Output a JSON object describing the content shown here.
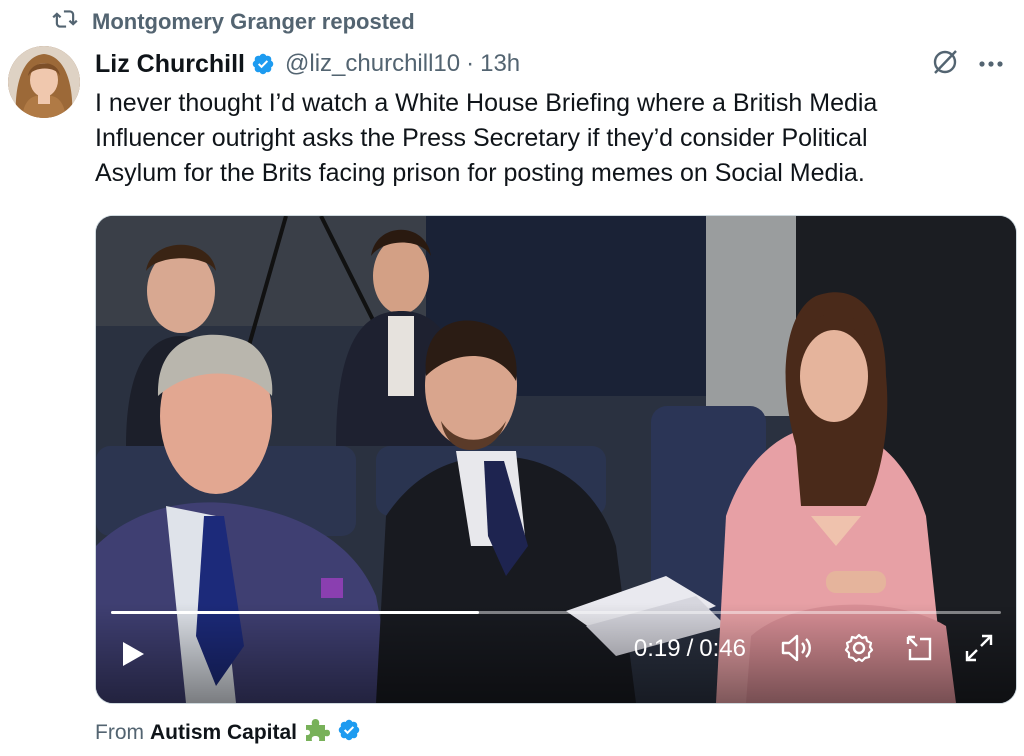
{
  "repost": {
    "icon": "retweet-icon",
    "text": "Montgomery Granger reposted"
  },
  "tweet": {
    "author_name": "Liz Churchill",
    "handle": "@liz_churchill10",
    "separator": "·",
    "time": "13h",
    "text_lines": [
      "I never thought I’d watch a White House Briefing where a British Media",
      "Influencer outright asks the Press Secretary if they’d consider Political",
      "Asylum for the Brits facing prison for posting memes on Social Media."
    ],
    "verified_icon": "verified-badge-icon",
    "grok_icon": "grok-icon",
    "more_icon": "more-options-icon"
  },
  "video": {
    "current_time": "0:19",
    "time_separator": "/",
    "duration": "0:46",
    "progress_fraction": 0.413,
    "icons": [
      "play-icon",
      "volume-icon",
      "settings-icon",
      "dock-icon",
      "fullscreen-icon"
    ]
  },
  "source": {
    "prefix": "From",
    "name": "Autism Capital",
    "emoji_icon": "puzzle-piece-icon",
    "verified_icon": "verified-badge-icon"
  },
  "colors": {
    "verified_blue": "#1d9bf0",
    "secondary_text": "#536471",
    "puzzle_green": "#78b159"
  }
}
